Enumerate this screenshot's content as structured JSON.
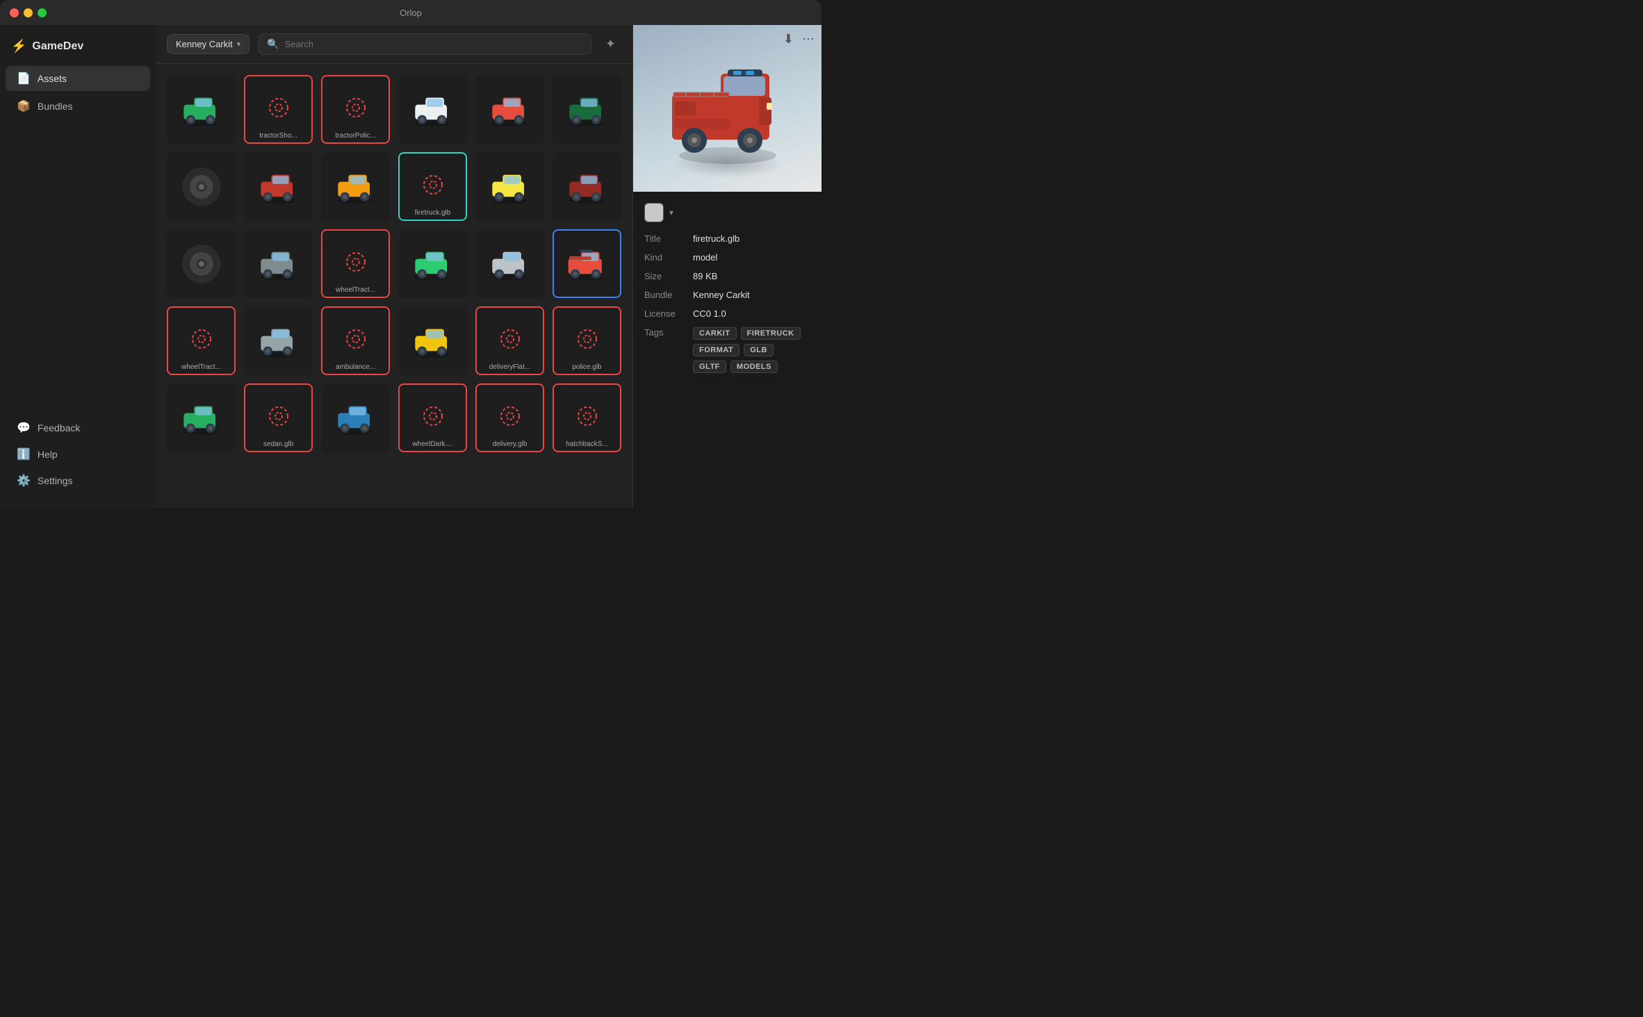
{
  "app": {
    "title": "Orlop"
  },
  "titlebar": {
    "title": "Orlop"
  },
  "sidebar": {
    "brand": {
      "icon": "⚡",
      "label": "GameDev"
    },
    "items": [
      {
        "id": "assets",
        "icon": "📄",
        "label": "Assets",
        "active": true
      },
      {
        "id": "bundles",
        "icon": "📦",
        "label": "Bundles",
        "active": false
      }
    ],
    "bottom_items": [
      {
        "id": "feedback",
        "icon": "💬",
        "label": "Feedback"
      },
      {
        "id": "help",
        "icon": "ℹ️",
        "label": "Help"
      },
      {
        "id": "settings",
        "icon": "⚙️",
        "label": "Settings"
      }
    ]
  },
  "searchbar": {
    "bundle_label": "Kenney Carkit",
    "placeholder": "Search",
    "filter_icon": "✦"
  },
  "assets": [
    {
      "id": "a1",
      "type": "vehicle",
      "color": "green",
      "label": "",
      "state": "normal"
    },
    {
      "id": "a2",
      "type": "missing",
      "label": "tractorSho...",
      "state": "missing"
    },
    {
      "id": "a3",
      "type": "missing",
      "label": "tractorPolic...",
      "state": "missing"
    },
    {
      "id": "a4",
      "type": "vehicle",
      "color": "white",
      "label": "",
      "state": "normal"
    },
    {
      "id": "a5",
      "type": "vehicle",
      "color": "red",
      "label": "",
      "state": "normal"
    },
    {
      "id": "a6",
      "type": "vehicle",
      "color": "darkgreen",
      "label": "",
      "state": "normal"
    },
    {
      "id": "a7",
      "type": "wheel",
      "label": "",
      "state": "normal"
    },
    {
      "id": "a8",
      "type": "vehicle",
      "color": "red2",
      "label": "",
      "state": "normal"
    },
    {
      "id": "a9",
      "type": "vehicle",
      "color": "yellow",
      "label": "",
      "state": "normal"
    },
    {
      "id": "a10",
      "type": "missing",
      "label": "firetruck.glb",
      "state": "selected-cyan"
    },
    {
      "id": "a11",
      "type": "vehicle",
      "color": "cream",
      "label": "",
      "state": "normal"
    },
    {
      "id": "a12",
      "type": "vehicle",
      "color": "darkred",
      "label": "",
      "state": "normal"
    },
    {
      "id": "a13",
      "type": "wheel",
      "label": "",
      "state": "normal"
    },
    {
      "id": "a14",
      "type": "vehicle",
      "color": "police",
      "label": "",
      "state": "normal"
    },
    {
      "id": "a15",
      "type": "missing",
      "label": "wheelTract...",
      "state": "missing"
    },
    {
      "id": "a16",
      "type": "vehicle",
      "color": "green2",
      "label": "",
      "state": "normal"
    },
    {
      "id": "a17",
      "type": "vehicle",
      "color": "ambulance",
      "label": "",
      "state": "normal"
    },
    {
      "id": "a18",
      "type": "firetruck-small",
      "label": "",
      "state": "selected-blue"
    },
    {
      "id": "a19",
      "type": "missing",
      "label": "wheelTract...",
      "state": "missing"
    },
    {
      "id": "a20",
      "type": "vehicle",
      "color": "police2",
      "label": "",
      "state": "normal"
    },
    {
      "id": "a21",
      "type": "missing",
      "label": "ambulance...",
      "state": "missing"
    },
    {
      "id": "a22",
      "type": "vehicle",
      "color": "tractor",
      "label": "",
      "state": "normal"
    },
    {
      "id": "a23",
      "type": "missing",
      "label": "deliveryFlat...",
      "state": "missing"
    },
    {
      "id": "a24",
      "type": "missing",
      "label": "police.glb",
      "state": "missing"
    },
    {
      "id": "a25",
      "type": "vehicle",
      "color": "pickup-green",
      "label": "",
      "state": "normal"
    },
    {
      "id": "a26",
      "type": "missing",
      "label": "sedan.glb",
      "state": "missing"
    },
    {
      "id": "a27",
      "type": "vehicle",
      "color": "racecar",
      "label": "",
      "state": "normal"
    },
    {
      "id": "a28",
      "type": "missing",
      "label": "wheelDark....",
      "state": "missing"
    },
    {
      "id": "a29",
      "type": "missing",
      "label": "delivery.glb",
      "state": "missing"
    },
    {
      "id": "a30",
      "type": "missing",
      "label": "hatchbackS...",
      "state": "missing"
    }
  ],
  "details": {
    "download_icon": "⬇",
    "more_icon": "⋯",
    "title": "firetruck.glb",
    "kind": "model",
    "size": "89 KB",
    "bundle": "Kenney Carkit",
    "license": "CC0 1.0",
    "tags": [
      "CARKIT",
      "FIRETRUCK",
      "FORMAT",
      "GLB",
      "GLTF",
      "MODELS"
    ],
    "labels": {
      "title": "Title",
      "kind": "Kind",
      "size": "Size",
      "bundle": "Bundle",
      "license": "License",
      "tags": "Tags"
    }
  }
}
